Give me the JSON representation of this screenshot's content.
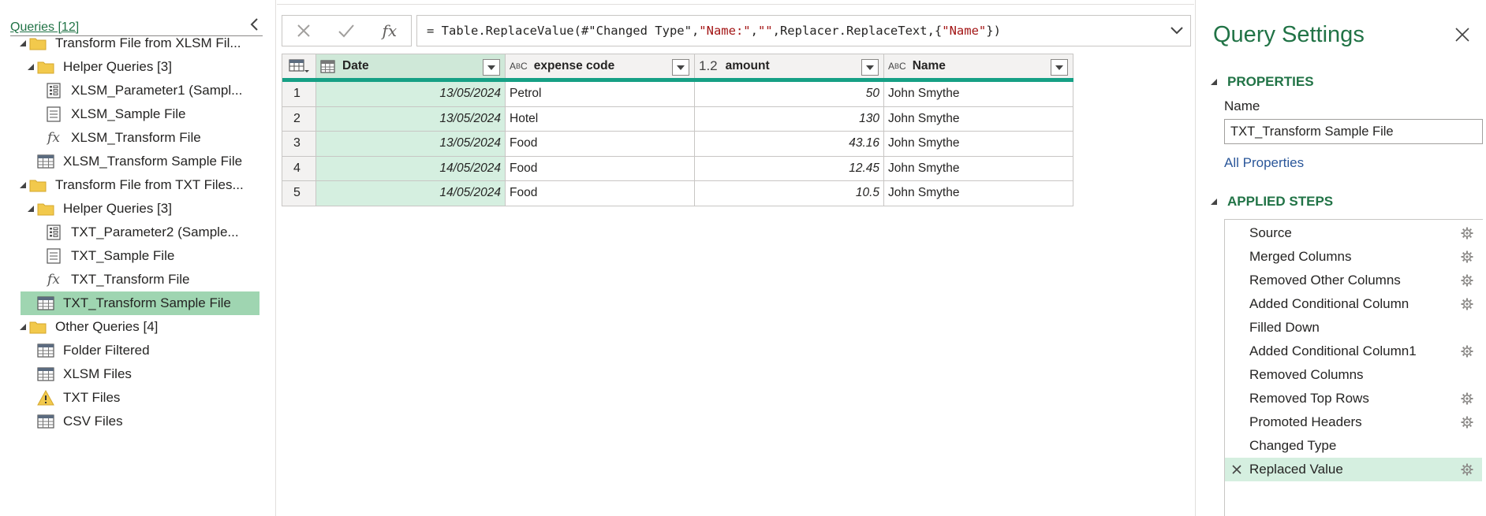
{
  "queries_pane": {
    "header": "Queries [12]",
    "items": [
      {
        "label": "Transform File from XLSM Fil...",
        "icon": "folder-icon",
        "level": 0,
        "expanded": true
      },
      {
        "label": "Helper Queries [3]",
        "icon": "folder-icon",
        "level": 1,
        "expanded": true
      },
      {
        "label": "XLSM_Parameter1 (Sampl...",
        "icon": "parameter-icon",
        "level": 2
      },
      {
        "label": "XLSM_Sample File",
        "icon": "document-icon",
        "level": 2
      },
      {
        "label": "XLSM_Transform File",
        "icon": "function-icon",
        "level": 2
      },
      {
        "label": "XLSM_Transform Sample File",
        "icon": "table-icon",
        "level": 1
      },
      {
        "label": "Transform File from TXT Files...",
        "icon": "folder-icon",
        "level": 0,
        "expanded": true
      },
      {
        "label": "Helper Queries [3]",
        "icon": "folder-icon",
        "level": 1,
        "expanded": true
      },
      {
        "label": "TXT_Parameter2 (Sample...",
        "icon": "parameter-icon",
        "level": 2
      },
      {
        "label": "TXT_Sample File",
        "icon": "document-icon",
        "level": 2
      },
      {
        "label": "TXT_Transform File",
        "icon": "function-icon",
        "level": 2
      },
      {
        "label": "TXT_Transform Sample File",
        "icon": "table-icon",
        "level": 1,
        "selected": true
      },
      {
        "label": "Other Queries [4]",
        "icon": "folder-icon",
        "level": 0,
        "expanded": true
      },
      {
        "label": "Folder Filtered",
        "icon": "table-icon",
        "level": 1
      },
      {
        "label": "XLSM Files",
        "icon": "table-icon",
        "level": 1
      },
      {
        "label": "TXT Files",
        "icon": "warning-icon",
        "level": 1
      },
      {
        "label": "CSV Files",
        "icon": "table-icon",
        "level": 1
      }
    ]
  },
  "formula_bar": {
    "cancel_icon": "close-icon",
    "commit_icon": "check-icon",
    "fx_label": "fx",
    "formula_parts": [
      {
        "text": "= Table.ReplaceValue(#\"Changed Type\",",
        "str": false
      },
      {
        "text": "\"Name:\"",
        "str": true
      },
      {
        "text": ",",
        "str": false
      },
      {
        "text": "\"\"",
        "str": true
      },
      {
        "text": ",Replacer.ReplaceText,{",
        "str": false
      },
      {
        "text": "\"Name\"",
        "str": true
      },
      {
        "text": "})",
        "str": false
      }
    ]
  },
  "grid": {
    "columns": [
      {
        "key": "date",
        "name": "Date",
        "type_icon": "calendar-icon"
      },
      {
        "key": "exp",
        "name": "expense code",
        "type_label": "ABC"
      },
      {
        "key": "amt",
        "name": "amount",
        "type_label": "1.2"
      },
      {
        "key": "name",
        "name": "Name",
        "type_label": "ABC"
      }
    ],
    "rows": [
      {
        "idx": "1",
        "date": "13/05/2024",
        "exp": "Petrol",
        "amt": "50",
        "name": "John Smythe"
      },
      {
        "idx": "2",
        "date": "13/05/2024",
        "exp": "Hotel",
        "amt": "130",
        "name": "John Smythe"
      },
      {
        "idx": "3",
        "date": "13/05/2024",
        "exp": "Food",
        "amt": "43.16",
        "name": "John Smythe"
      },
      {
        "idx": "4",
        "date": "14/05/2024",
        "exp": "Food",
        "amt": "12.45",
        "name": "John Smythe"
      },
      {
        "idx": "5",
        "date": "14/05/2024",
        "exp": "Food",
        "amt": "10.5",
        "name": "John Smythe"
      }
    ]
  },
  "query_settings": {
    "title": "Query Settings",
    "properties_label": "PROPERTIES",
    "name_label": "Name",
    "name_value": "TXT_Transform Sample File",
    "all_properties_link": "All Properties",
    "applied_steps_label": "APPLIED STEPS",
    "steps": [
      {
        "label": "Source",
        "gear": true
      },
      {
        "label": "Merged Columns",
        "gear": true
      },
      {
        "label": "Removed Other Columns",
        "gear": true
      },
      {
        "label": "Added Conditional Column",
        "gear": true
      },
      {
        "label": "Filled Down",
        "gear": false
      },
      {
        "label": "Added Conditional Column1",
        "gear": true
      },
      {
        "label": "Removed Columns",
        "gear": false
      },
      {
        "label": "Removed Top Rows",
        "gear": true
      },
      {
        "label": "Promoted Headers",
        "gear": true
      },
      {
        "label": "Changed Type",
        "gear": false
      },
      {
        "label": "Replaced Value",
        "gear": true,
        "selected": true
      }
    ]
  },
  "colors": {
    "accent_green": "#217346",
    "selected_query_bg": "#9fd5b1",
    "selected_column_bg": "#d5efe0",
    "column_quality_bar": "#16a085"
  }
}
